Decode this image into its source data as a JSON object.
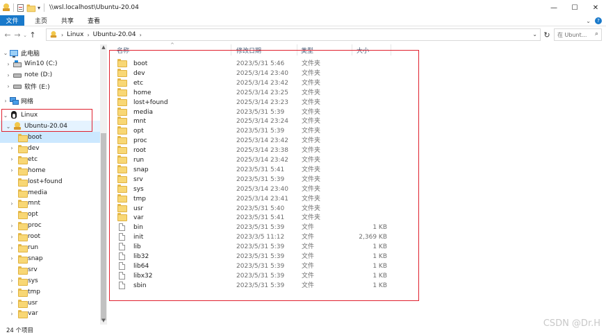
{
  "window": {
    "path_title": "\\\\wsl.localhost\\Ubuntu-20.04",
    "controls": {
      "minimize": "—",
      "maximize": "☐",
      "close": "✕"
    }
  },
  "ribbon": {
    "tabs": [
      {
        "label": "文件",
        "active": true
      },
      {
        "label": "主页",
        "active": false
      },
      {
        "label": "共享",
        "active": false
      },
      {
        "label": "查看",
        "active": false
      }
    ],
    "expand_icon": "chevron-down-icon",
    "help_icon": "help-icon"
  },
  "address": {
    "crumbs": [
      "Linux",
      "Ubuntu-20.04"
    ],
    "search_placeholder": "在 Ubunt..."
  },
  "tree": {
    "this_pc": "此电脑",
    "drives": [
      "Win10 (C:)",
      "note (D:)",
      "软件 (E:)"
    ],
    "network": "网络",
    "linux": "Linux",
    "distro": "Ubuntu-20.04",
    "folders": [
      {
        "label": "boot",
        "expandable": false,
        "selected": true
      },
      {
        "label": "dev",
        "expandable": true
      },
      {
        "label": "etc",
        "expandable": true
      },
      {
        "label": "home",
        "expandable": true
      },
      {
        "label": "lost+found",
        "expandable": false
      },
      {
        "label": "media",
        "expandable": false
      },
      {
        "label": "mnt",
        "expandable": true
      },
      {
        "label": "opt",
        "expandable": false
      },
      {
        "label": "proc",
        "expandable": true
      },
      {
        "label": "root",
        "expandable": true
      },
      {
        "label": "run",
        "expandable": true
      },
      {
        "label": "snap",
        "expandable": true
      },
      {
        "label": "srv",
        "expandable": false
      },
      {
        "label": "sys",
        "expandable": true
      },
      {
        "label": "tmp",
        "expandable": true
      },
      {
        "label": "usr",
        "expandable": true
      },
      {
        "label": "var",
        "expandable": true
      }
    ]
  },
  "list": {
    "columns": {
      "name": "名称",
      "date": "修改日期",
      "type": "类型",
      "size": "大小"
    },
    "rows": [
      {
        "name": "boot",
        "date": "2023/5/31 5:46",
        "type": "文件夹",
        "size": "",
        "kind": "folder"
      },
      {
        "name": "dev",
        "date": "2025/3/14 23:40",
        "type": "文件夹",
        "size": "",
        "kind": "folder"
      },
      {
        "name": "etc",
        "date": "2025/3/14 23:42",
        "type": "文件夹",
        "size": "",
        "kind": "folder"
      },
      {
        "name": "home",
        "date": "2025/3/14 23:25",
        "type": "文件夹",
        "size": "",
        "kind": "folder"
      },
      {
        "name": "lost+found",
        "date": "2025/3/14 23:23",
        "type": "文件夹",
        "size": "",
        "kind": "folder"
      },
      {
        "name": "media",
        "date": "2023/5/31 5:39",
        "type": "文件夹",
        "size": "",
        "kind": "folder"
      },
      {
        "name": "mnt",
        "date": "2025/3/14 23:24",
        "type": "文件夹",
        "size": "",
        "kind": "folder"
      },
      {
        "name": "opt",
        "date": "2023/5/31 5:39",
        "type": "文件夹",
        "size": "",
        "kind": "folder"
      },
      {
        "name": "proc",
        "date": "2025/3/14 23:42",
        "type": "文件夹",
        "size": "",
        "kind": "folder"
      },
      {
        "name": "root",
        "date": "2025/3/14 23:38",
        "type": "文件夹",
        "size": "",
        "kind": "folder"
      },
      {
        "name": "run",
        "date": "2025/3/14 23:42",
        "type": "文件夹",
        "size": "",
        "kind": "folder"
      },
      {
        "name": "snap",
        "date": "2023/5/31 5:41",
        "type": "文件夹",
        "size": "",
        "kind": "folder"
      },
      {
        "name": "srv",
        "date": "2023/5/31 5:39",
        "type": "文件夹",
        "size": "",
        "kind": "folder"
      },
      {
        "name": "sys",
        "date": "2025/3/14 23:40",
        "type": "文件夹",
        "size": "",
        "kind": "folder"
      },
      {
        "name": "tmp",
        "date": "2025/3/14 23:41",
        "type": "文件夹",
        "size": "",
        "kind": "folder"
      },
      {
        "name": "usr",
        "date": "2023/5/31 5:40",
        "type": "文件夹",
        "size": "",
        "kind": "folder"
      },
      {
        "name": "var",
        "date": "2023/5/31 5:41",
        "type": "文件夹",
        "size": "",
        "kind": "folder"
      },
      {
        "name": "bin",
        "date": "2023/5/31 5:39",
        "type": "文件",
        "size": "1 KB",
        "kind": "file"
      },
      {
        "name": "init",
        "date": "2023/3/5 11:12",
        "type": "文件",
        "size": "2,369 KB",
        "kind": "file"
      },
      {
        "name": "lib",
        "date": "2023/5/31 5:39",
        "type": "文件",
        "size": "1 KB",
        "kind": "file"
      },
      {
        "name": "lib32",
        "date": "2023/5/31 5:39",
        "type": "文件",
        "size": "1 KB",
        "kind": "file"
      },
      {
        "name": "lib64",
        "date": "2023/5/31 5:39",
        "type": "文件",
        "size": "1 KB",
        "kind": "file"
      },
      {
        "name": "libx32",
        "date": "2023/5/31 5:39",
        "type": "文件",
        "size": "1 KB",
        "kind": "file"
      },
      {
        "name": "sbin",
        "date": "2023/5/31 5:39",
        "type": "文件",
        "size": "1 KB",
        "kind": "file"
      }
    ]
  },
  "status": {
    "count": "24 个项目"
  },
  "watermark": "CSDN @Dr.H",
  "colors": {
    "accent": "#1979ca",
    "annotation": "#e0202e",
    "selection": "#cce8ff",
    "folder": "#f8d775"
  }
}
